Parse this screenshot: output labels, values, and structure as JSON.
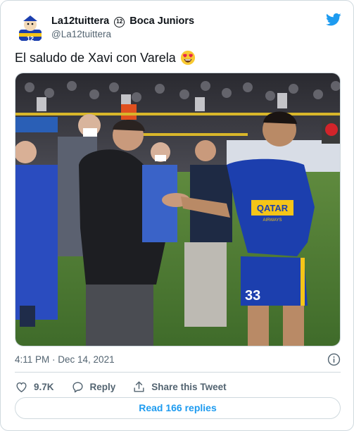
{
  "tweet": {
    "display_name": "La12tuittera",
    "badge": "12",
    "display_name_suffix": "Boca Juniors",
    "handle": "@La12tuittera",
    "text": "El saludo de Xavi con Varela",
    "emoji": "heart-eyes-emoji",
    "timestamp": "4:11 PM · Dec 14, 2021"
  },
  "media": {
    "shirt_sponsor": "QATAR",
    "shirt_sponsor_sub": "AIRWAYS",
    "shirt_number": "33"
  },
  "actions": {
    "likes": "9.7K",
    "reply_label": "Reply",
    "share_label": "Share this Tweet"
  },
  "replies_button": "Read 166 replies",
  "colors": {
    "accent": "#1d9bf0",
    "secondary_text": "#536471",
    "border": "#cfd9de",
    "boca_blue": "#1c3fae",
    "boca_yellow": "#f5c518"
  }
}
